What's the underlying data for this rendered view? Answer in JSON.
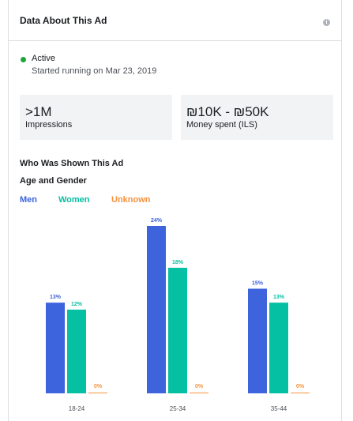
{
  "header": {
    "title": "Data About This Ad",
    "info_icon": "info-icon"
  },
  "status": {
    "label": "Active",
    "started": "Started running on Mar 23, 2019",
    "color": "#1ea63c"
  },
  "stats": [
    {
      "value": ">1M",
      "label": "Impressions"
    },
    {
      "value": "₪10K - ₪50K",
      "label": "Money spent (ILS)"
    }
  ],
  "section": {
    "title": "Who Was Shown This Ad",
    "subtitle": "Age and Gender"
  },
  "colors": {
    "men": "#3d63dd",
    "women": "#05c0a2",
    "unknown": "#f5923e"
  },
  "chart_data": {
    "type": "bar",
    "categories": [
      "18-24",
      "25-34",
      "35-44"
    ],
    "series": [
      {
        "name": "Men",
        "values": [
          13,
          24,
          15
        ],
        "labels": [
          "13%",
          "24%",
          "15%"
        ]
      },
      {
        "name": "Women",
        "values": [
          12,
          18,
          13
        ],
        "labels": [
          "12%",
          "18%",
          "13%"
        ]
      },
      {
        "name": "Unknown",
        "values": [
          0,
          0,
          0
        ],
        "labels": [
          "0%",
          "0%",
          "0%"
        ]
      }
    ],
    "ylim": [
      0,
      24
    ],
    "legend": "top-left",
    "grid": false
  }
}
